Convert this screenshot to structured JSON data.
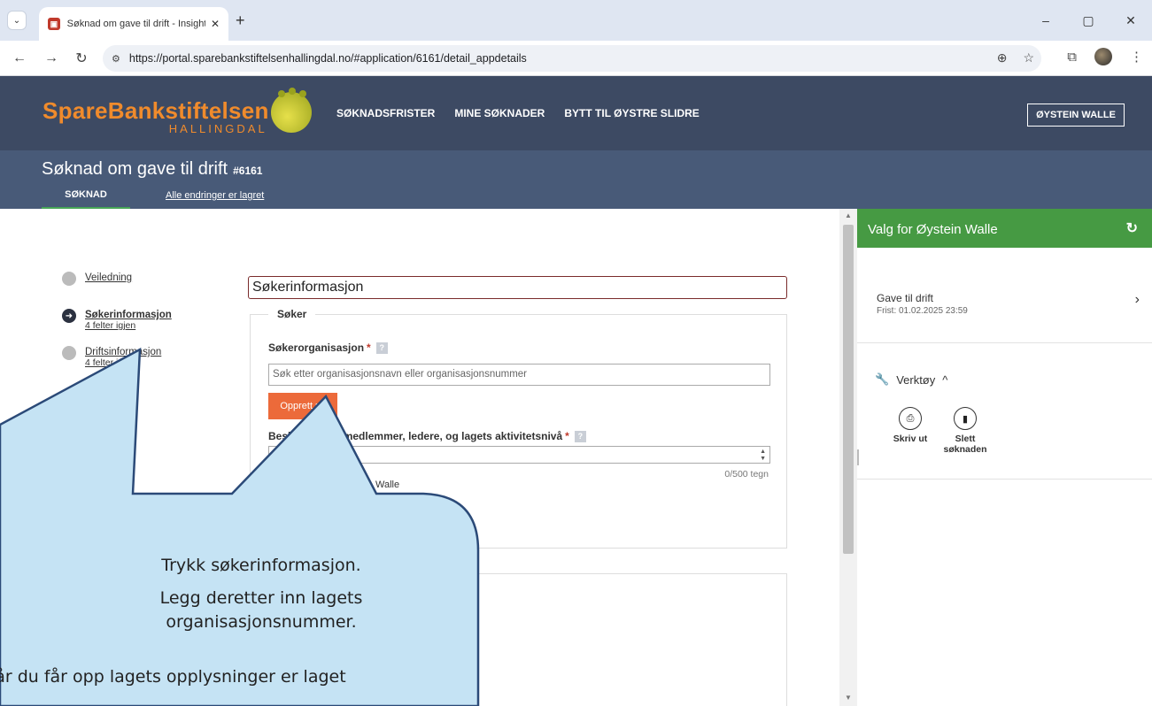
{
  "browser": {
    "tab_title": "Søknad om gave til drift - Insight",
    "url": "https://portal.sparebankstiftelsenhallingdal.no/#application/6161/detail_appdetails"
  },
  "site": {
    "logo_main": "SpareBankstiftelsen",
    "logo_sub": "HALLINGDAL",
    "nav": [
      "SØKNADSFRISTER",
      "MINE SØKNADER",
      "BYTT TIL ØYSTRE SLIDRE"
    ],
    "user": "ØYSTEIN WALLE"
  },
  "app": {
    "title": "Søknad om gave til drift",
    "number": "#6161",
    "tab": "SØKNAD",
    "saved": "Alle endringer er lagret"
  },
  "steps": [
    {
      "label": "Veiledning",
      "sub": ""
    },
    {
      "label": "Søkerinformasjon",
      "sub": "4 felter igjen"
    },
    {
      "label": "Driftsinformasjon",
      "sub": "4 felter igjen"
    }
  ],
  "form": {
    "section_title": "Søkerinformasjon",
    "legend": "Søker",
    "org_label": "Søkerorganisasjon",
    "org_placeholder": "Søk etter organisasjonsnavn eller organisasjonsnummer",
    "create_button": "Opprett ny",
    "desc_label": "Beskriv lagets medlemmer, ledere, og lagets aktivitetsnivå",
    "counter": "0/500 tegn",
    "contact_name": "Walle",
    "required_mark": "*",
    "help_mark": "?"
  },
  "right_panel": {
    "title": "Valg for Øystein Walle",
    "grant_name": "Gave til drift",
    "grant_deadline": "Frist: 01.02.2025 23:59",
    "tools_label": "Verktøy",
    "print_label": "Skriv ut",
    "delete_label": "Slett søknaden"
  },
  "callout": {
    "line1": "Trykk søkerinformasjon.",
    "line2": "Legg deretter inn lagets organisasjonsnummer.",
    "line3": "Når du får opp lagets opplysninger er laget"
  }
}
